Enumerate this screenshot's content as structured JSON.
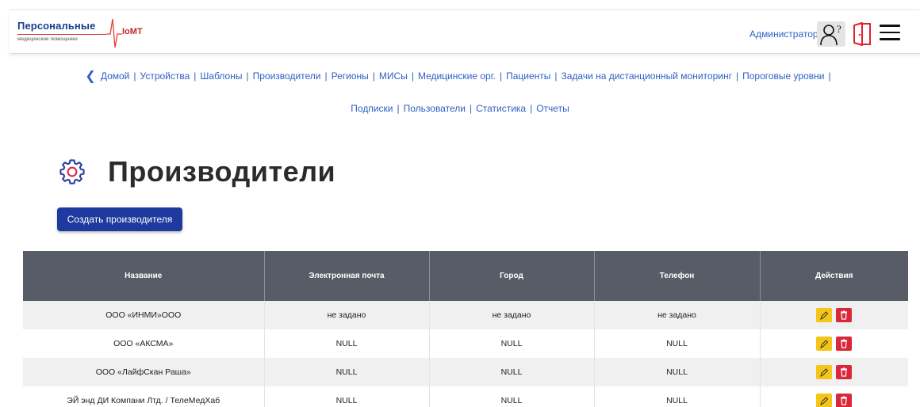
{
  "header": {
    "logo_title": "Персональные",
    "logo_subtitle": "медицинские помощники",
    "logo_brand": "IoMT",
    "user_label": "Администратор"
  },
  "icons": {
    "help": "help-question-icon",
    "logout": "logout-door-icon",
    "menu": "hamburger-menu-icon",
    "back": "chevron-left-icon",
    "settings": "gear-icon",
    "edit": "pencil-icon",
    "delete": "trash-icon"
  },
  "nav": {
    "back": "Домой",
    "line1": [
      "Устройства",
      "Шаблоны",
      "Производители",
      "Регионы",
      "МИСы",
      "Медицинские орг.",
      "Пациенты",
      "Задачи на дистанционный мониторинг",
      "Пороговые уровни"
    ],
    "line2": [
      "Подписки",
      "Пользователи",
      "Статистика",
      "Отчеты"
    ]
  },
  "page": {
    "title": "Производители",
    "create_button": "Создать производителя"
  },
  "table": {
    "columns": [
      "Название",
      "Электронная почта",
      "Город",
      "Телефон",
      "Действия"
    ],
    "rows": [
      {
        "name": "ООО «ИНМИ»ООО",
        "email": "не задано",
        "city": "не задано",
        "phone": "не задано"
      },
      {
        "name": "ООО «АКСМА»",
        "email": "NULL",
        "city": "NULL",
        "phone": "NULL"
      },
      {
        "name": "ООО «ЛайфСкан Раша»",
        "email": "NULL",
        "city": "NULL",
        "phone": "NULL"
      },
      {
        "name": "ЭЙ энд ДИ Компани Лтд. / ТелеМедХаб",
        "email": "NULL",
        "city": "NULL",
        "phone": "NULL"
      }
    ]
  },
  "colors": {
    "accent": "#1e3a9e",
    "link": "#2e5fc4",
    "table_header": "#575c66",
    "edit": "#f5c518",
    "delete": "#d9283a",
    "brand_red": "#c62828"
  }
}
